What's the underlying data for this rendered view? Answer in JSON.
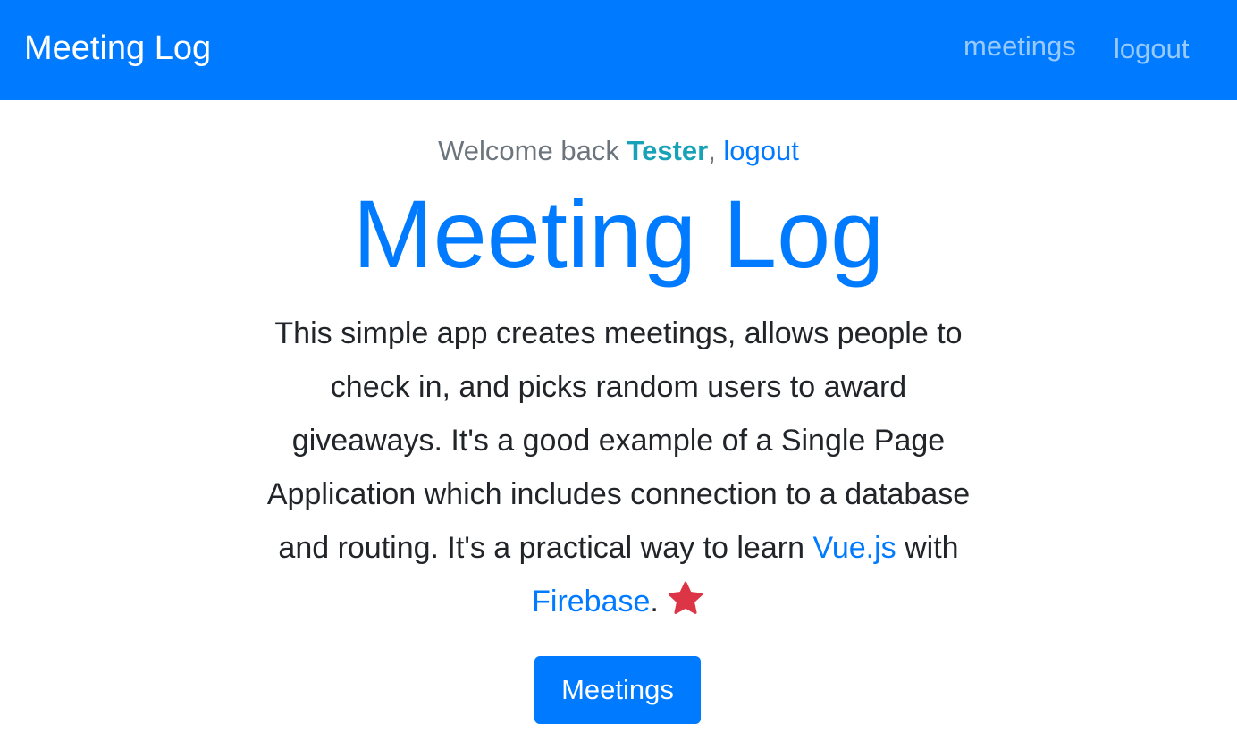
{
  "navbar": {
    "brand": "Meeting Log",
    "links": {
      "meetings": "meetings",
      "logout": "logout"
    },
    "background_color": "#007bff"
  },
  "welcome": {
    "prefix": "Welcome back ",
    "user_name": "Tester",
    "separator": ", ",
    "logout_link": "logout"
  },
  "hero": {
    "title": "Meeting Log",
    "description_part1": "This simple app creates meetings, allows people to check in, and picks random users to award giveaways. It's a good example of a Single Page Application which includes connection to a database and routing. It's a practical way to learn ",
    "link_vue": "Vue.js",
    "with_text": " with ",
    "link_firebase": "Firebase",
    "period": ".",
    "star_icon": "star-icon",
    "star_color": "#dc3545",
    "button_label": "Meetings"
  }
}
